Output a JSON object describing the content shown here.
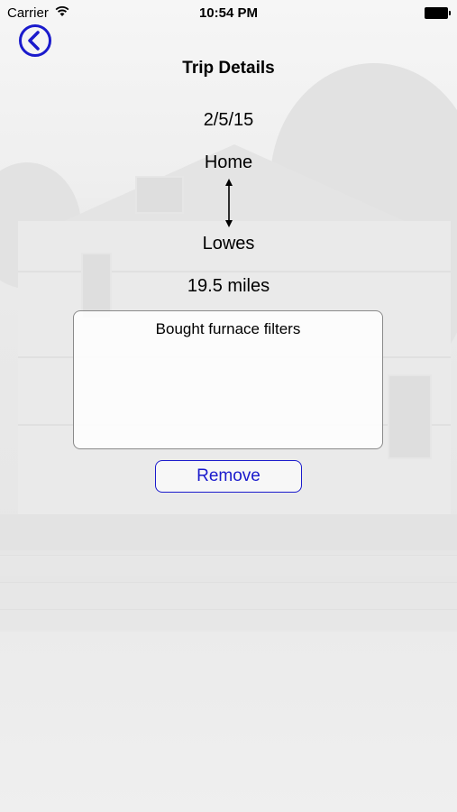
{
  "status_bar": {
    "carrier": "Carrier",
    "time": "10:54 PM",
    "wifi_icon": "wifi-icon",
    "battery_icon": "battery-icon"
  },
  "nav": {
    "back_icon": "chevron-left-circle-icon"
  },
  "trip": {
    "title": "Trip Details",
    "date": "2/5/15",
    "origin": "Home",
    "route_icon": "double-arrow-vertical-icon",
    "destination": "Lowes",
    "distance": "19.5 miles",
    "notes": "Bought furnace filters"
  },
  "actions": {
    "remove_label": "Remove"
  },
  "colors": {
    "accent": "#1a1acc",
    "background": "#ececec"
  }
}
